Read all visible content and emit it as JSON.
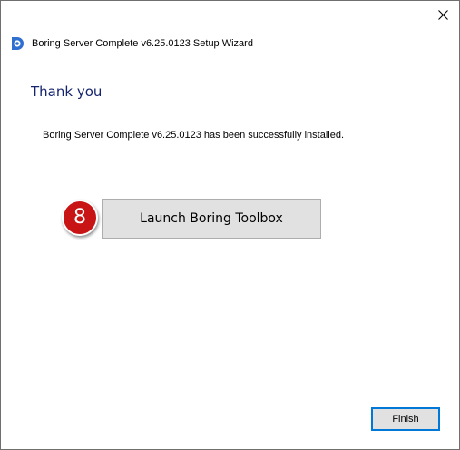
{
  "window": {
    "title": "Boring Server Complete v6.25.0123 Setup Wizard",
    "close_icon": "close-icon",
    "app_icon": "app-icon"
  },
  "content": {
    "heading": "Thank you",
    "message": "Boring Server Complete v6.25.0123 has been successfully installed."
  },
  "annotation": {
    "step_number": "8",
    "color": "#c81414"
  },
  "buttons": {
    "launch_label": "Launch Boring Toolbox",
    "finish_label": "Finish"
  },
  "colors": {
    "heading": "#15246e",
    "button_face": "#e1e1e1",
    "focus_border": "#0078d7"
  }
}
